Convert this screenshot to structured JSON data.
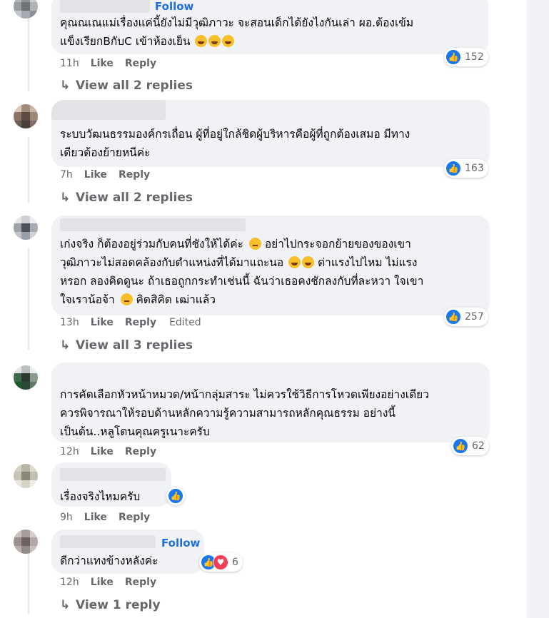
{
  "actions": {
    "like": "Like",
    "reply": "Reply",
    "follow": "Follow",
    "edited": "Edited"
  },
  "comments": [
    {
      "follow": true,
      "lines": [
        "คุณณเณแม่เรื่องแค่นี้ยังไม่มีวุฒิภาวะ จะสอนเด็กได้ยังไงกันเล่า ผอ.ต้องเข้ม",
        "แข็งเรียกBกับC เข้าห้องเย็น"
      ],
      "time": "11h",
      "reactions": "152",
      "replies": "View all 2 replies"
    },
    {
      "lines": [
        "ระบบวัฒนธรรมองค์กรเถื่อน ผู้ที่อยู่ใกล้ชิดผู้บริหารคือผู้ที่ถูกต้องเสมอ มีทาง",
        "เดียวต้องย้ายหนีค่ะ"
      ],
      "time": "7h",
      "reactions": "163",
      "replies": "View all 2 replies"
    },
    {
      "lines": [
        "เก่งจริง ก็ต้องอยู่ร่วมกับคนที่ชังให้ได้ค่ะ",
        "อย่าไปกระจอกย้ายของของเขา",
        "วุฒิภาวะไม่สอดคล้องกับตำแหน่งที่ได้มาแถะนอ",
        "ด่าแรงไปไหม ไม่แรง",
        "หรอก ลองคิดดูนะ ถ้าเธอถูกกระทำเช่นนี้ ฉันว่าเธอคงชักลงกับที่ละหวา ใจเขา",
        "ใจเราน้อจ้า",
        "คิดสิคิด เฒ่าแล้ว"
      ],
      "time": "13h",
      "edited": true,
      "reactions": "257",
      "replies": "View all 3 replies"
    },
    {
      "lines": [
        "การคัดเลือกหัวหน้าหมวด/หน้ากลุ่มสาระ ไม่ควรใช้วิธีการโหวตเพียงอย่างเดียว",
        "ควรพิจารณาให้รอบด้านหลักความรู้ความสามารถหลักคุณธรรม อย่างนี้",
        "เป็นต้น..หลูโตนคุณครูเนาะครับ"
      ],
      "time": "12h",
      "reactions": "62"
    },
    {
      "lines": [
        "เรื่องจริงไหมครับ"
      ],
      "time": "9h"
    },
    {
      "follow": true,
      "lines": [
        "ดีกว่าแทงข้างหลังค่ะ"
      ],
      "time": "12h",
      "reactions": "6",
      "replies": "View 1 reply"
    }
  ],
  "icons": {
    "like": "like-icon",
    "love": "love-icon",
    "reply_arrow": "reply-arrow-icon"
  }
}
